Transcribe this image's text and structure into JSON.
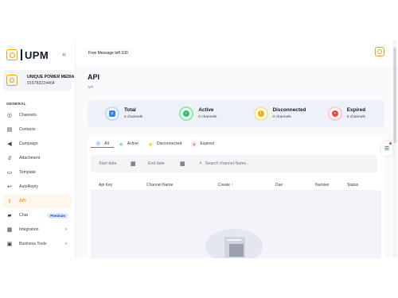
{
  "brand": {
    "name": "UPM"
  },
  "user": {
    "name": "UNIQUE POWER MEDIA",
    "phone": "919783224404"
  },
  "sidebar": {
    "section_label": "GENERAL",
    "items": [
      {
        "label": "Channels",
        "icon": "whatsapp-icon"
      },
      {
        "label": "Contacts",
        "icon": "contacts-icon"
      },
      {
        "label": "Campaign",
        "icon": "megaphone-icon"
      },
      {
        "label": "Attachment",
        "icon": "paperclip-icon"
      },
      {
        "label": "Template",
        "icon": "template-icon"
      },
      {
        "label": "AutoReply",
        "icon": "reply-icon"
      },
      {
        "label": "API",
        "icon": "key-icon",
        "active": true
      },
      {
        "label": "Chat",
        "icon": "chat-icon",
        "badge": "Premium"
      },
      {
        "label": "Integration",
        "icon": "integration-icon"
      },
      {
        "label": "Business Tools",
        "icon": "briefcase-icon"
      }
    ]
  },
  "topbar": {
    "free_message": "Free Message left 100"
  },
  "page": {
    "title": "API",
    "breadcrumb": "API"
  },
  "stats": [
    {
      "title": "Total",
      "sub": "0 channels",
      "color": "#3b82f6"
    },
    {
      "title": "Active",
      "sub": "0 channels",
      "color": "#22c55e"
    },
    {
      "title": "Disconnected",
      "sub": "0 channels",
      "color": "#eab308"
    },
    {
      "title": "Expired",
      "sub": "0 channels",
      "color": "#ef4444"
    }
  ],
  "tabs": [
    {
      "count": "0",
      "label": "All",
      "color": "#3b82f6",
      "bg": "#dbeafe"
    },
    {
      "count": "0",
      "label": "Active",
      "color": "#16a34a",
      "bg": "#dcfce7"
    },
    {
      "count": "0",
      "label": "Disconnected",
      "color": "#ca8a04",
      "bg": "#fef9c3"
    },
    {
      "count": "0",
      "label": "Expired",
      "color": "#dc2626",
      "bg": "#fee2e2"
    }
  ],
  "filters": {
    "start_date": "Start date",
    "end_date": "End date",
    "search_placeholder": "Search channel Name..."
  },
  "table": {
    "columns": [
      "Api Key",
      "Channel Name",
      "Create ↑",
      "Due",
      "Number",
      "Status"
    ]
  }
}
